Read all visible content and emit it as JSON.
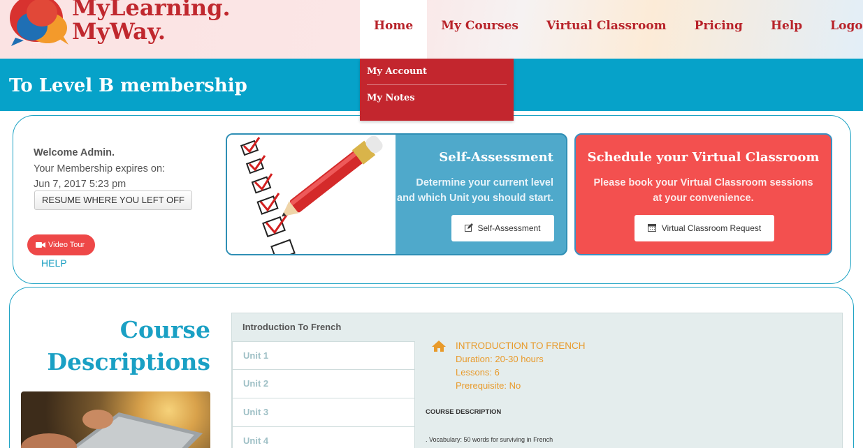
{
  "brand": {
    "line1": "MyLearning.",
    "line2": "MyWay."
  },
  "nav": {
    "items": [
      {
        "label": "Home"
      },
      {
        "label": "My Courses"
      },
      {
        "label": "Virtual Classroom"
      },
      {
        "label": "Pricing"
      },
      {
        "label": "Help"
      },
      {
        "label": "Logout"
      }
    ]
  },
  "dropdown": {
    "items": [
      {
        "label": "My Account"
      },
      {
        "label": "My Notes"
      }
    ]
  },
  "banner": {
    "title": "To Level B membership"
  },
  "account": {
    "welcome": "Welcome Admin.",
    "expires_label": "Your Membership expires on:",
    "expires_date": "Jun 7, 2017 5:23 pm",
    "resume_button": "RESUME WHERE YOU LEFT OFF",
    "video_tour_button": "Video Tour",
    "help_link": "HELP"
  },
  "self_assessment": {
    "title": "Self-Assessment",
    "line1": "Determine your current level",
    "line2": "and which Unit you should start.",
    "button": "Self-Assessment"
  },
  "virtual_classroom": {
    "title": "Schedule your Virtual Classroom",
    "line1": "Please book your Virtual Classroom sessions",
    "line2": "at your convenience.",
    "button": "Virtual Classroom Request"
  },
  "course_descriptions": {
    "title_line1": "Course",
    "title_line2": "Descriptions",
    "intro_tab": "Introduction To French",
    "units": [
      "Unit 1",
      "Unit 2",
      "Unit 3",
      "Unit 4"
    ],
    "detail": {
      "title": "INTRODUCTION TO FRENCH",
      "duration": "Duration: 20-30 hours",
      "lessons": "Lessons: 6",
      "prerequisite": "Prerequisite: No"
    },
    "description_label": "COURSE DESCRIPTION",
    "vocab_line": ". Vocabulary: 50 words for surviving in French"
  },
  "colors": {
    "brand_red": "#c0282e",
    "banner_blue": "#06a2c9",
    "sa_blue": "#4fa9cb",
    "vc_red": "#f3504f",
    "accent_orange": "#e89a2a"
  }
}
